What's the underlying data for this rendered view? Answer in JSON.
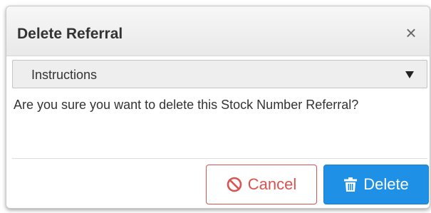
{
  "dialog": {
    "title": "Delete Referral",
    "close_icon": "close-icon",
    "close_glyph": "×"
  },
  "instructions": {
    "label": "Instructions",
    "icon": "caret-down-icon"
  },
  "message": "Are you sure you want to delete this Stock Number Referral?",
  "buttons": {
    "cancel": {
      "label": "Cancel",
      "icon": "ban-icon",
      "color": "#d9534f"
    },
    "delete": {
      "label": "Delete",
      "icon": "trash-icon",
      "color": "#1e90e6"
    }
  }
}
